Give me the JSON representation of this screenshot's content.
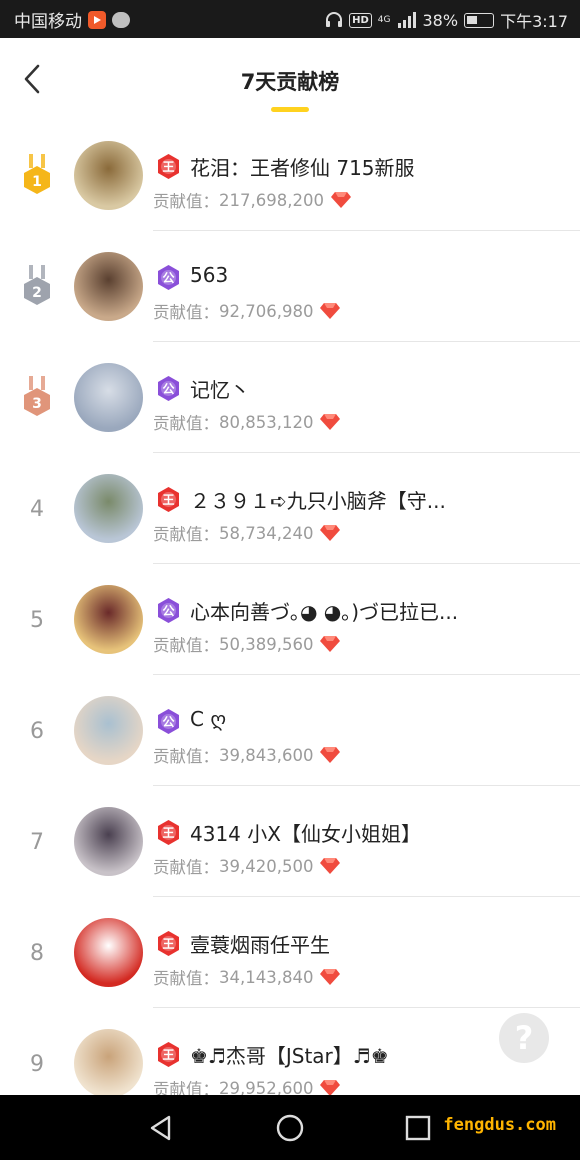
{
  "status_bar": {
    "carrier": "中国移动",
    "battery": "38%",
    "time": "下午3:17",
    "hd_label": "HD",
    "network_label": "4G"
  },
  "header": {
    "title": "7天贡献榜",
    "back_icon": "chevron-left-icon",
    "accent_color": "#ffd21f"
  },
  "leaderboard": {
    "contribution_label": "贡献值：",
    "entries": [
      {
        "rank": "1",
        "badge_char": "王",
        "badge_type": "king",
        "name": "花泪：王者修仙 715新服",
        "value": "217,698,200"
      },
      {
        "rank": "2",
        "badge_char": "公",
        "badge_type": "duke",
        "name": "563",
        "value": "92,706,980"
      },
      {
        "rank": "3",
        "badge_char": "公",
        "badge_type": "duke",
        "name": "记忆丶",
        "value": "80,853,120"
      },
      {
        "rank": "4",
        "badge_char": "王",
        "badge_type": "king",
        "name": "２３９１➪九只小脑斧【守...",
        "value": "58,734,240"
      },
      {
        "rank": "5",
        "badge_char": "公",
        "badge_type": "duke",
        "name": "心本向善づ｡◕ ◕｡)づ已拉已...",
        "value": "50,389,560"
      },
      {
        "rank": "6",
        "badge_char": "公",
        "badge_type": "duke",
        "name": "C ღ",
        "value": "39,843,600"
      },
      {
        "rank": "7",
        "badge_char": "王",
        "badge_type": "king",
        "name": "4314 小X【仙女小姐姐】",
        "value": "39,420,500"
      },
      {
        "rank": "8",
        "badge_char": "王",
        "badge_type": "king",
        "name": "壹蓑烟雨任平生",
        "value": "34,143,840"
      },
      {
        "rank": "9",
        "badge_char": "王",
        "badge_type": "king",
        "name": "♚♬杰哥【JStar】♬♚",
        "value": "29,952,600"
      }
    ]
  },
  "help_button": {
    "label": "?"
  },
  "watermark": "fengdus.com",
  "colors": {
    "gold": "#f5b619",
    "silver": "#9ea3ad",
    "bronze": "#e0957a",
    "king_badge": "#e8322f",
    "duke_badge": "#8a4fd9",
    "gem": "#f04b3e"
  }
}
